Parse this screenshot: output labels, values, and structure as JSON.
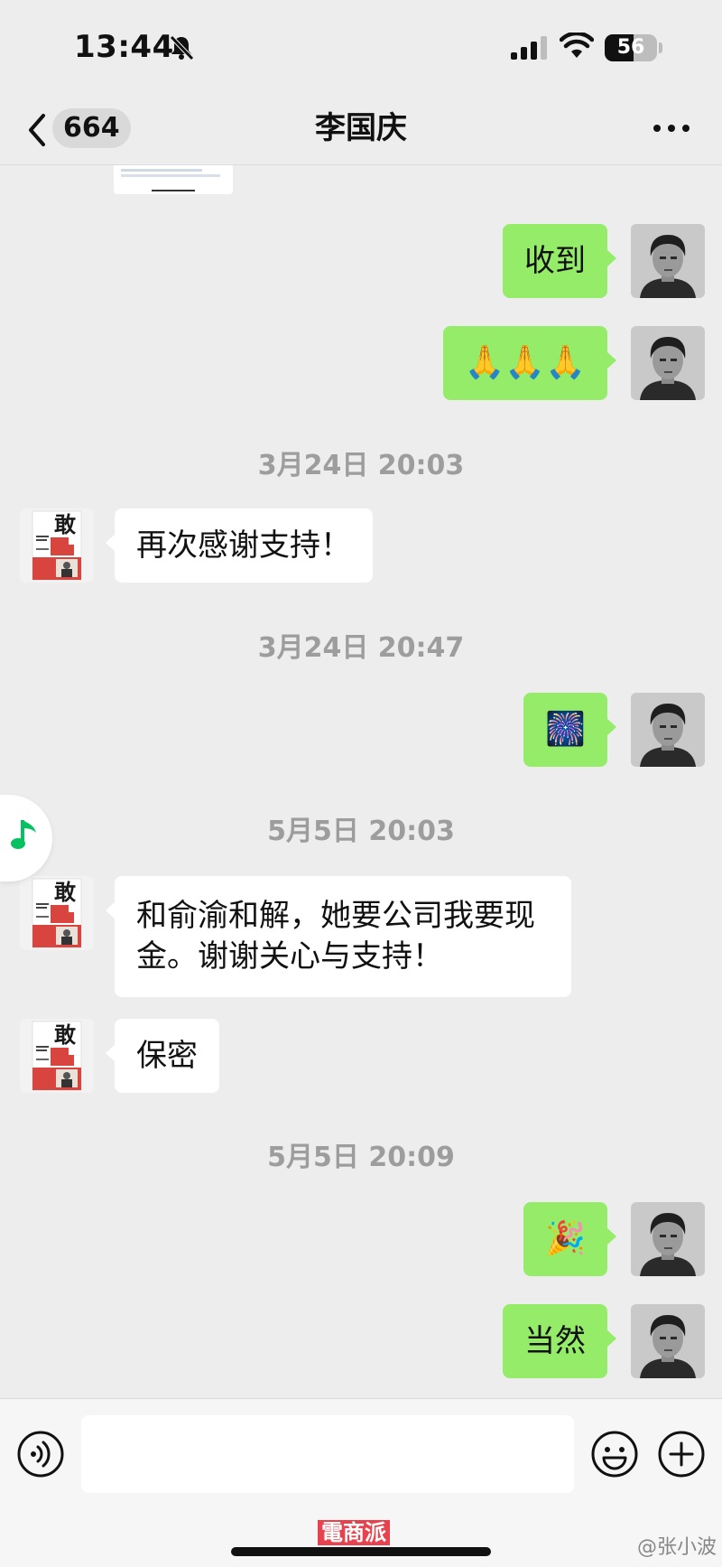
{
  "status_bar": {
    "time": "13:44",
    "battery": "56",
    "battery_level": 0.56
  },
  "nav": {
    "unread_count": "664",
    "title": "李国庆"
  },
  "messages": [
    {
      "side": "out",
      "text": "收到"
    },
    {
      "side": "out",
      "text": "🙏🙏🙏"
    },
    {
      "timestamp": "3月24日 20:03"
    },
    {
      "side": "in",
      "text": "再次感谢支持！"
    },
    {
      "timestamp": "3月24日 20:47"
    },
    {
      "side": "out",
      "text": "🎆"
    },
    {
      "timestamp": "5月5日 20:03"
    },
    {
      "side": "in",
      "text": "和俞渝和解，她要公司我要现金。谢谢关心与支持！"
    },
    {
      "side": "in",
      "text": "保密"
    },
    {
      "timestamp": "5月5日 20:09"
    },
    {
      "side": "out",
      "text": "🎉"
    },
    {
      "side": "out",
      "text": "当然"
    }
  ],
  "avatars": {
    "book_title_char": "敢当"
  },
  "input": {
    "placeholder": ""
  },
  "icons": [
    "bell-slash-icon",
    "signal-icon",
    "wifi-icon",
    "battery-icon",
    "back-chevron-icon",
    "more-icon",
    "music-note-icon",
    "voice-icon",
    "emoji-icon",
    "plus-icon"
  ],
  "colors": {
    "outgoing_bubble": "#95ec69",
    "incoming_bubble": "#ffffff",
    "background": "#ededed",
    "music_green": "#07c160",
    "watermark": "#e7434e"
  },
  "watermark": {
    "text": "電商派",
    "weibo": "@张小波"
  }
}
